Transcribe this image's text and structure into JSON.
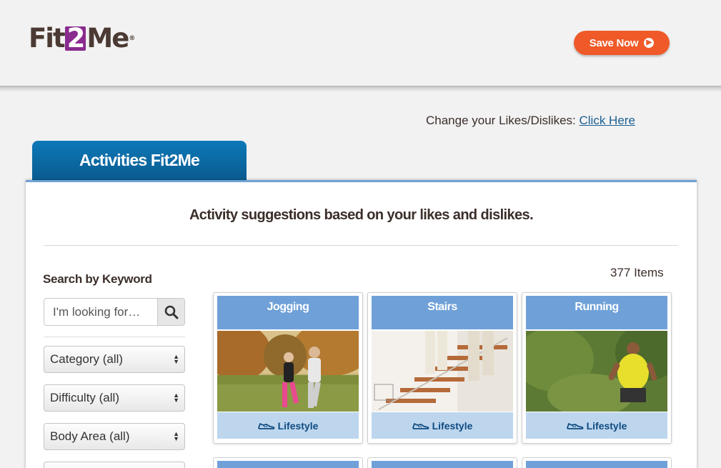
{
  "header": {
    "logo": {
      "pre": "Fit",
      "mid": "2",
      "post": "Me",
      "tm": "®"
    },
    "save_button": "Save Now"
  },
  "likes": {
    "label": "Change your Likes/Dislikes:",
    "link": "Click Here"
  },
  "tab": {
    "label": "Activities Fit2Me"
  },
  "panel": {
    "heading": "Activity suggestions based on your likes and dislikes.",
    "count": "377 Items"
  },
  "sidebar": {
    "search_label": "Search by Keyword",
    "search_placeholder": "I'm looking for…",
    "filters": [
      "Category (all)",
      "Difficulty (all)",
      "Body Area (all)"
    ]
  },
  "cards": [
    {
      "title": "Jogging",
      "tag": "Lifestyle"
    },
    {
      "title": "Stairs",
      "tag": "Lifestyle"
    },
    {
      "title": "Running",
      "tag": "Lifestyle"
    }
  ],
  "colors": {
    "accent_orange": "#ef5a28",
    "tab_blue": "#0a6aa6",
    "card_title_blue": "#6fa1d8",
    "card_foot_blue": "#bdd6ee",
    "logo_purple": "#8a2b8e"
  },
  "icons": [
    "search-icon",
    "sneaker-icon",
    "arrow-circle-right-icon",
    "select-arrows-icon"
  ]
}
